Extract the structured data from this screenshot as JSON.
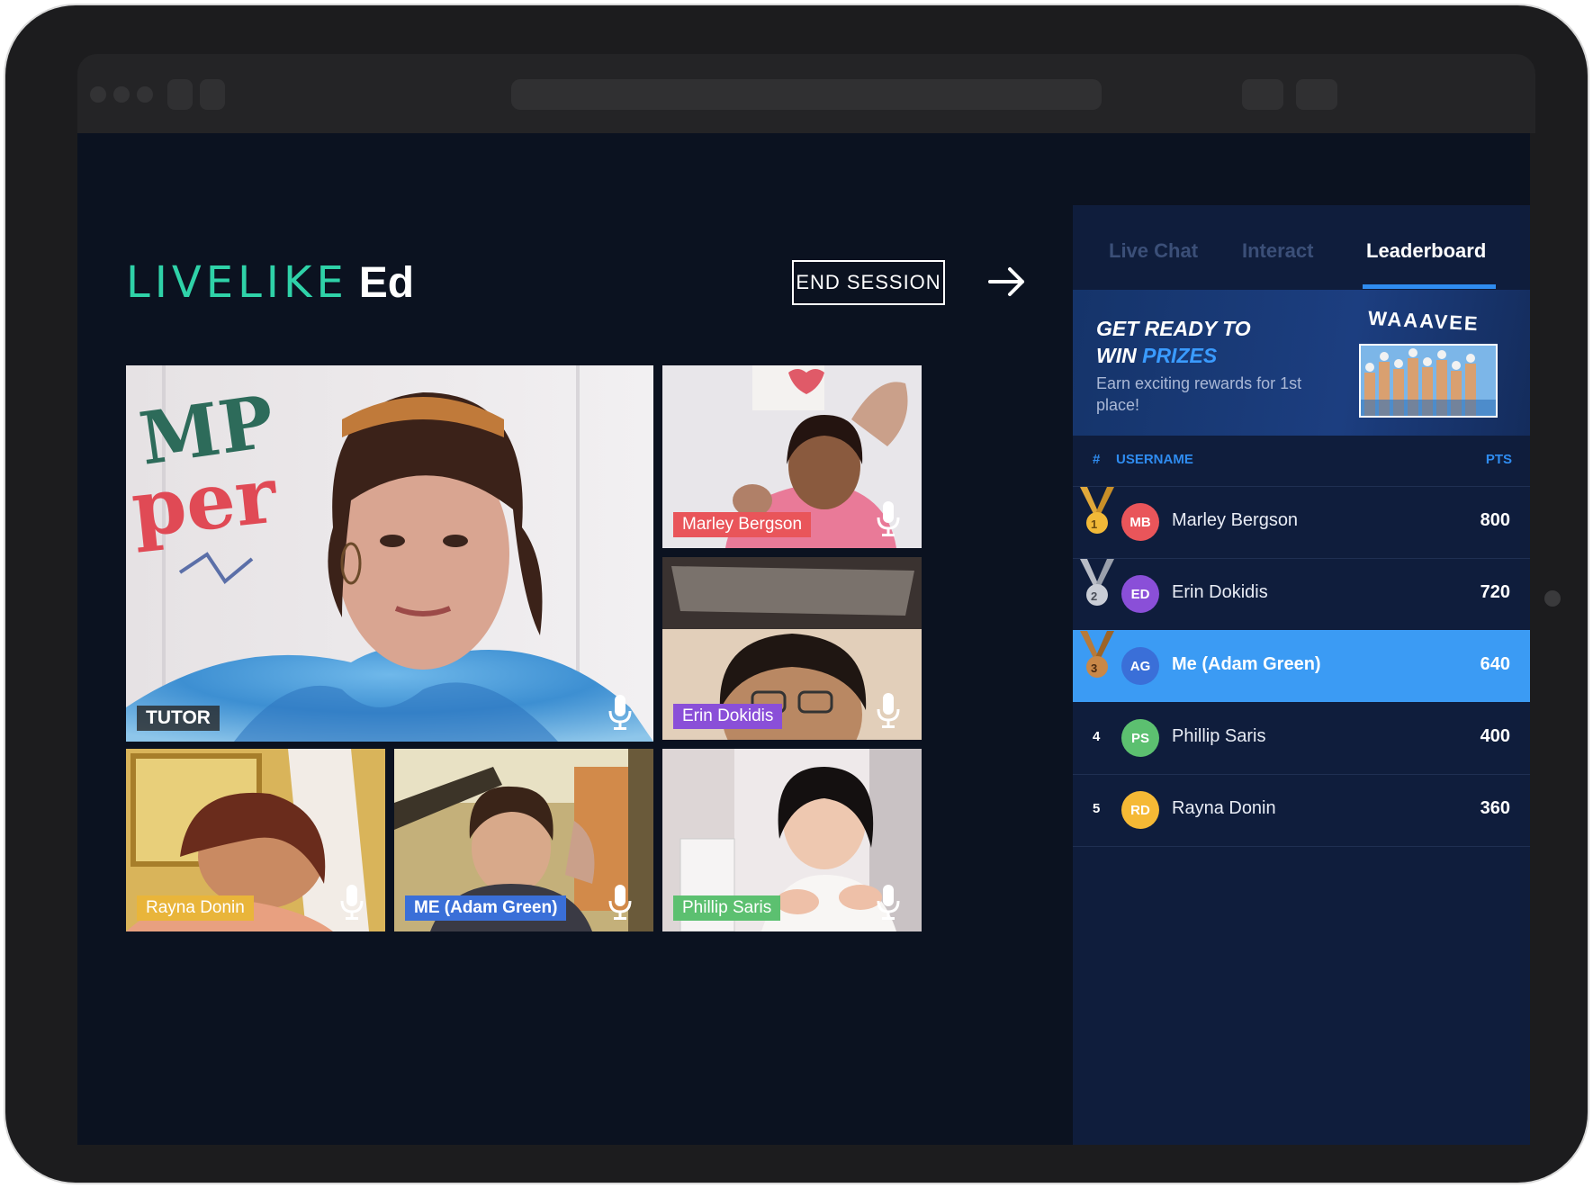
{
  "app": {
    "logo_brand": "LIVELIKE",
    "logo_suffix": "Ed",
    "end_session_label": "END SESSION"
  },
  "video_tiles": {
    "tutor": {
      "label": "TUTOR"
    },
    "marley": {
      "label": "Marley Bergson",
      "label_color": "#e9555a"
    },
    "erin": {
      "label": "Erin Dokidis",
      "label_color": "#8a4fd8"
    },
    "rayna": {
      "label": "Rayna Donin",
      "label_color": "#e9b53a"
    },
    "adam": {
      "label": "ME (Adam Green)",
      "label_color": "#3a6fd8"
    },
    "phillip": {
      "label": "Phillip Saris",
      "label_color": "#5cc070"
    }
  },
  "sidebar": {
    "tabs": [
      {
        "label": "Live Chat"
      },
      {
        "label": "Interact"
      },
      {
        "label": "Leaderboard"
      }
    ],
    "promo": {
      "title_line1": "GET READY TO",
      "title_win": "WIN ",
      "title_prizes": "PRIZES",
      "subtitle": "Earn exciting rewards for 1st place!",
      "art_text": "WAAAVEE"
    },
    "leaderboard": {
      "col_rank": "#",
      "col_user": "USERNAME",
      "col_pts": "PTS",
      "rows": [
        {
          "rank": "1",
          "initials": "MB",
          "name": "Marley Bergson",
          "pts": "800",
          "color": "#e9555a",
          "medal": "gold"
        },
        {
          "rank": "2",
          "initials": "ED",
          "name": "Erin Dokidis",
          "pts": "720",
          "color": "#8a4fd8",
          "medal": "silver"
        },
        {
          "rank": "3",
          "initials": "AG",
          "name": "Me (Adam Green)",
          "pts": "640",
          "color": "#3a6fd8",
          "medal": "bronze"
        },
        {
          "rank": "4",
          "initials": "PS",
          "name": "Phillip Saris",
          "pts": "400",
          "color": "#5cc070"
        },
        {
          "rank": "5",
          "initials": "RD",
          "name": "Rayna Donin",
          "pts": "360",
          "color": "#f5b935"
        }
      ]
    }
  }
}
